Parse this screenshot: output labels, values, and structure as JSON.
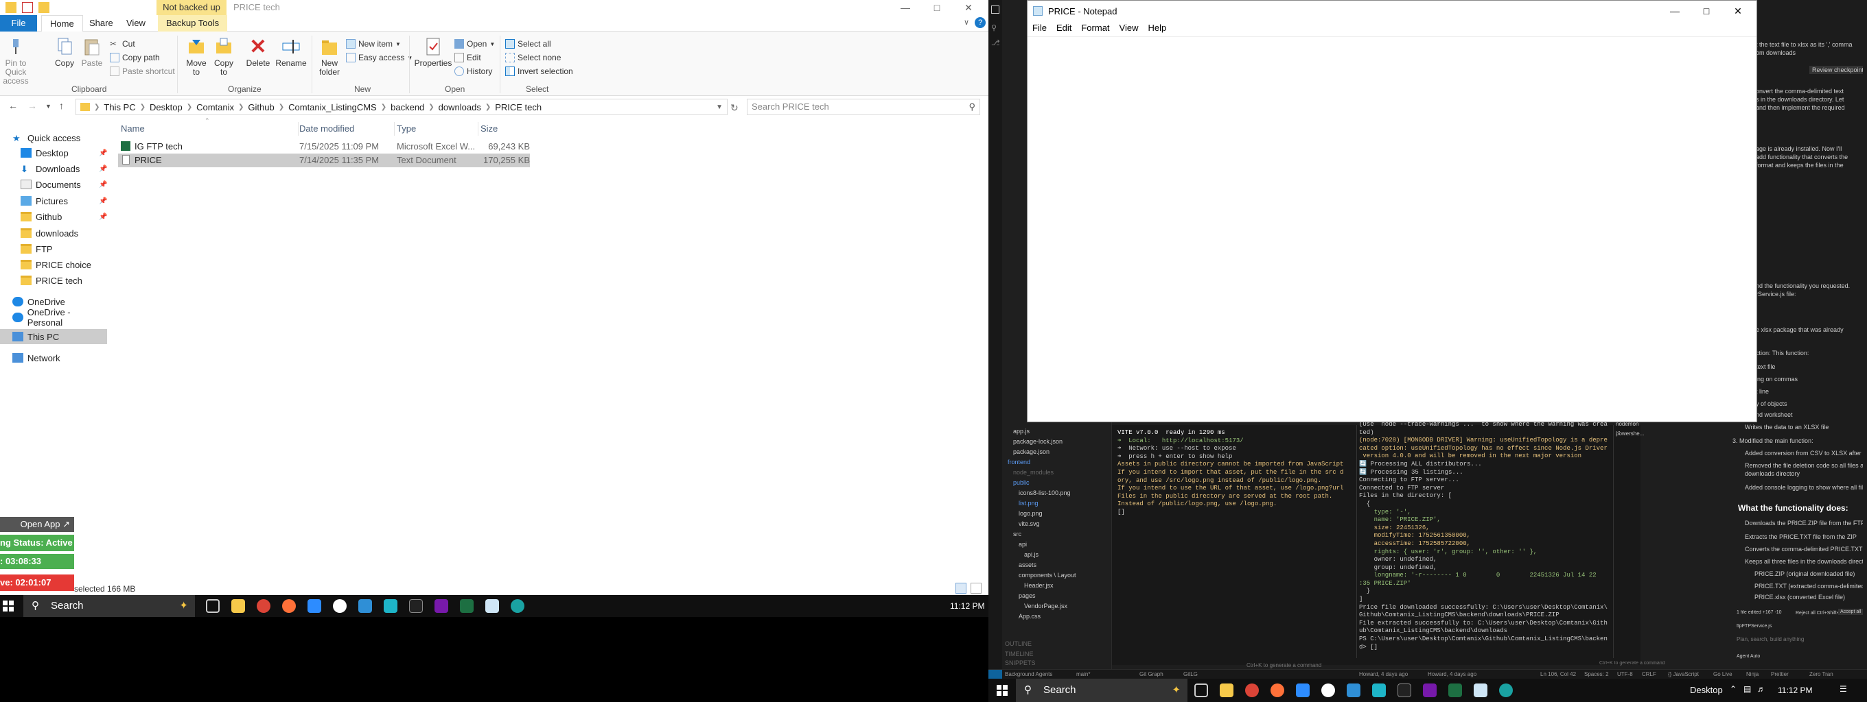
{
  "explorer": {
    "not_backed_up": "Not backed up",
    "title": "PRICE tech",
    "tabs": {
      "file": "File",
      "home": "Home",
      "share": "Share",
      "view": "View",
      "backup_tools": "Backup Tools"
    },
    "ribbon": {
      "pin": "Pin to Quick access",
      "copy": "Copy",
      "paste": "Paste",
      "cut": "Cut",
      "copy_path": "Copy path",
      "paste_shortcut": "Paste shortcut",
      "clipboard": "Clipboard",
      "move_to": "Move to",
      "copy_to": "Copy to",
      "delete": "Delete",
      "rename": "Rename",
      "organize": "Organize",
      "new_folder": "New folder",
      "new_item": "New item",
      "easy_access": "Easy access",
      "new": "New",
      "properties": "Properties",
      "open": "Open",
      "edit": "Edit",
      "history": "History",
      "open_group": "Open",
      "select_all": "Select all",
      "select_none": "Select none",
      "invert_selection": "Invert selection",
      "select": "Select"
    },
    "breadcrumb": [
      "This PC",
      "Desktop",
      "Comtanix",
      "Github",
      "Comtanix_ListingCMS",
      "backend",
      "downloads",
      "PRICE tech"
    ],
    "search_placeholder": "Search PRICE tech",
    "nav": {
      "quick_access": "Quick access",
      "desktop": "Desktop",
      "downloads": "Downloads",
      "documents": "Documents",
      "pictures": "Pictures",
      "github": "Github",
      "downloads2": "downloads",
      "ftp": "FTP",
      "price_choice": "PRICE choice",
      "price_tech": "PRICE tech",
      "onedrive": "OneDrive",
      "onedrive_personal": "OneDrive - Personal",
      "this_pc": "This PC",
      "network": "Network"
    },
    "columns": {
      "name": "Name",
      "date": "Date modified",
      "type": "Type",
      "size": "Size"
    },
    "files": [
      {
        "name": "IG FTP tech",
        "date": "7/15/2025 11:09 PM",
        "type": "Microsoft Excel W...",
        "size": "69,243 KB"
      },
      {
        "name": "PRICE",
        "date": "7/14/2025 11:35 PM",
        "type": "Text Document",
        "size": "170,255 KB"
      }
    ],
    "status": "selected  166 MB"
  },
  "overlay": {
    "open_app": "Open App ↗",
    "status": "ng Status: Active",
    "time1": ": 03:08:33",
    "time2": "ve: 02:01:07"
  },
  "taskbar_left": {
    "search": "Search",
    "time": "11:12 PM"
  },
  "notepad": {
    "title": "PRICE - Notepad",
    "menu": {
      "file": "File",
      "edit": "Edit",
      "format": "Format",
      "view": "View",
      "help": "Help"
    }
  },
  "vscode": {
    "tree": {
      "app_js": "app.js",
      "pkg_lock": "package-lock.json",
      "pkg": "package.json",
      "frontend": "frontend",
      "node_modules": "node_modules",
      "public": "public",
      "icon": "icons8-list-100.png",
      "list": "list.png",
      "logo": "logo.png",
      "vite": "vite.svg",
      "src": "src",
      "api": "api",
      "api_js": "api.js",
      "assets": "assets",
      "components": "components \\ Layout",
      "header": "Header.jsx",
      "pages": "pages",
      "vendor": "VendorPage.jsx",
      "app_css": "App.css",
      "outline": "OUTLINE",
      "timeline": "TIMELINE",
      "snippets": "SNIPPETS"
    },
    "term_left": {
      "l1": "VITE v7.0.0  ready in 1290 ms",
      "l2": "➜  Local:   http://localhost:5173/",
      "l3": "➜  Network: use --host to expose",
      "l4": "➜  press h + enter to show help",
      "l5": "Assets in public directory cannot be imported from JavaScript.",
      "l6": "If you intend to import that asset, put the file in the src direct",
      "l7": "ory, and use /src/logo.png instead of /public/logo.png.",
      "l8": "If you intend to use the URL of that asset, use /logo.png?url.",
      "l9": "Files in the public directory are served at the root path.",
      "l10": "Instead of /public/logo.png, use /logo.png."
    },
    "term_mid": {
      "l1": "(Use `node --trace-warnings ...` to show where the warning was crea",
      "l2": "ted)",
      "l3": "(node:7028) [MONGODB DRIVER] Warning: useUnifiedTopology is a depre",
      "l4": "cated option: useUnifiedTopology has no effect since Node.js Driver",
      " l5": "",
      "l5": " version 4.0.0 and will be removed in the next major version",
      "l6": "🔄 Processing ALL distributors...",
      "l7": "🔄 Processing 35 listings...",
      "l8": "Connecting to FTP server...",
      "l9": "Connected to FTP server",
      "l10": "Files in the directory: [",
      "l11": "  {",
      "l12": "    type: '-',",
      "l13": "    name: 'PRICE.ZIP',",
      "l14": "    size: 22451326,",
      "l15": "    modifyTime: 1752561350000,",
      "l16": "    accessTime: 1752585722000,",
      "l17": "    rights: { user: 'r', group: '', other: '' },",
      "l18": "    owner: undefined,",
      "l19": "    group: undefined,",
      "l20": "    longname: '-r-------- 1 0        0        22451326 Jul 14 22",
      "l21": ":35 PRICE.ZIP'",
      "l22": "  }",
      "l23": "]",
      "l24": "Price file downloaded successfully: C:\\Users\\user\\Desktop\\Comtanix\\",
      "l25": "Github\\Comtanix_ListingCMS\\backend\\downloads\\PRICE.ZIP",
      "l26": "File extracted successfully to: C:\\Users\\user\\Desktop\\Comtanix\\Gith",
      "l27": "ub\\Comtanix_ListingCMS\\backend\\downloads",
      "l28": "PS C:\\Users\\user\\Desktop\\Comtanix\\Github\\Comtanix_ListingCMS\\backen",
      "l29": "d> []"
    },
    "term_tabs": {
      "node": "nodemon ...",
      "pwsh": "powershe..."
    },
    "hint": "Ctrl+K to generate a command",
    "chat": {
      "l1": "t the text file to xlsx as its ',' comma",
      "l2": "om downloads",
      "l3": "Review checkpoint",
      "l4": "onvert the comma-delimited text",
      "l5": "s in the downloads directory. Let",
      "l6": "and then implement the required",
      "l7": "age is already installed. Now I'll",
      "l8": "add functionality that converts the",
      "l9": "format and keeps the files in the",
      "l10": "nd the functionality you requested.",
      "l11": "rService.js file:",
      "l12": "e xlsx package that was already",
      "l13": "ction: This function:",
      "l14": "text file",
      "l15": "ing on commas",
      "l16": "t line",
      "l17": "y of objects",
      "l18": "nd worksheet",
      "l19": "Writes the data to an XLSX file",
      "l20": "3. Modified the main function:",
      "l21": "Added conversion from CSV to XLSX after extracting the ZIP file",
      "l22": "Removed the file deletion code so all files are kept in the",
      "l23": "downloads directory",
      "l24": "Added console logging to show where all files are saved",
      "heading": "What the functionality does:",
      "l25": "Downloads the PRICE.ZIP file from the FTP server",
      "l26": "Extracts the PRICE.TXT file from the ZIP",
      "l27": "Converts the comma-delimited PRICE.TXT to PRICE.xlsx",
      "l28": "Keeps all three files in the downloads directory:",
      "l29": "PRICE.ZIP (original downloaded file)",
      "l30": "PRICE.TXT (extracted comma-delimited file)",
      "l31": "PRICE.xlsx (converted Excel file)",
      "l32": "1 file edited +167 -10",
      "l33": "Reject all   Ctrl+Shift+⌫",
      "l34": "Accept all",
      "l35": "ftpFTPService.js",
      "l36": "Plan, search, build anything",
      "l37": "Agent  Auto",
      "l38": "Ctrl+K to generate a command"
    },
    "statusbar": {
      "bg_agents": "Background Agents",
      "main": "main*",
      "git_graph": "Git Graph",
      "gitlg": "GitLG",
      "howard1": "Howard, 4 days ago",
      "howard2": "Howard, 4 days ago",
      "ln": "Ln 106, Col 42",
      "spaces": "Spaces: 2",
      "utf": "UTF-8",
      "crlf": "CRLF",
      "lang": "{} JavaScript",
      "golive": "Go Live",
      "ninja": "Ninja",
      "prettier": "Prettier",
      "zero": "Zero Tran"
    }
  },
  "taskbar_right": {
    "search": "Search",
    "desktop": "Desktop",
    "time": "11:12 PM"
  }
}
